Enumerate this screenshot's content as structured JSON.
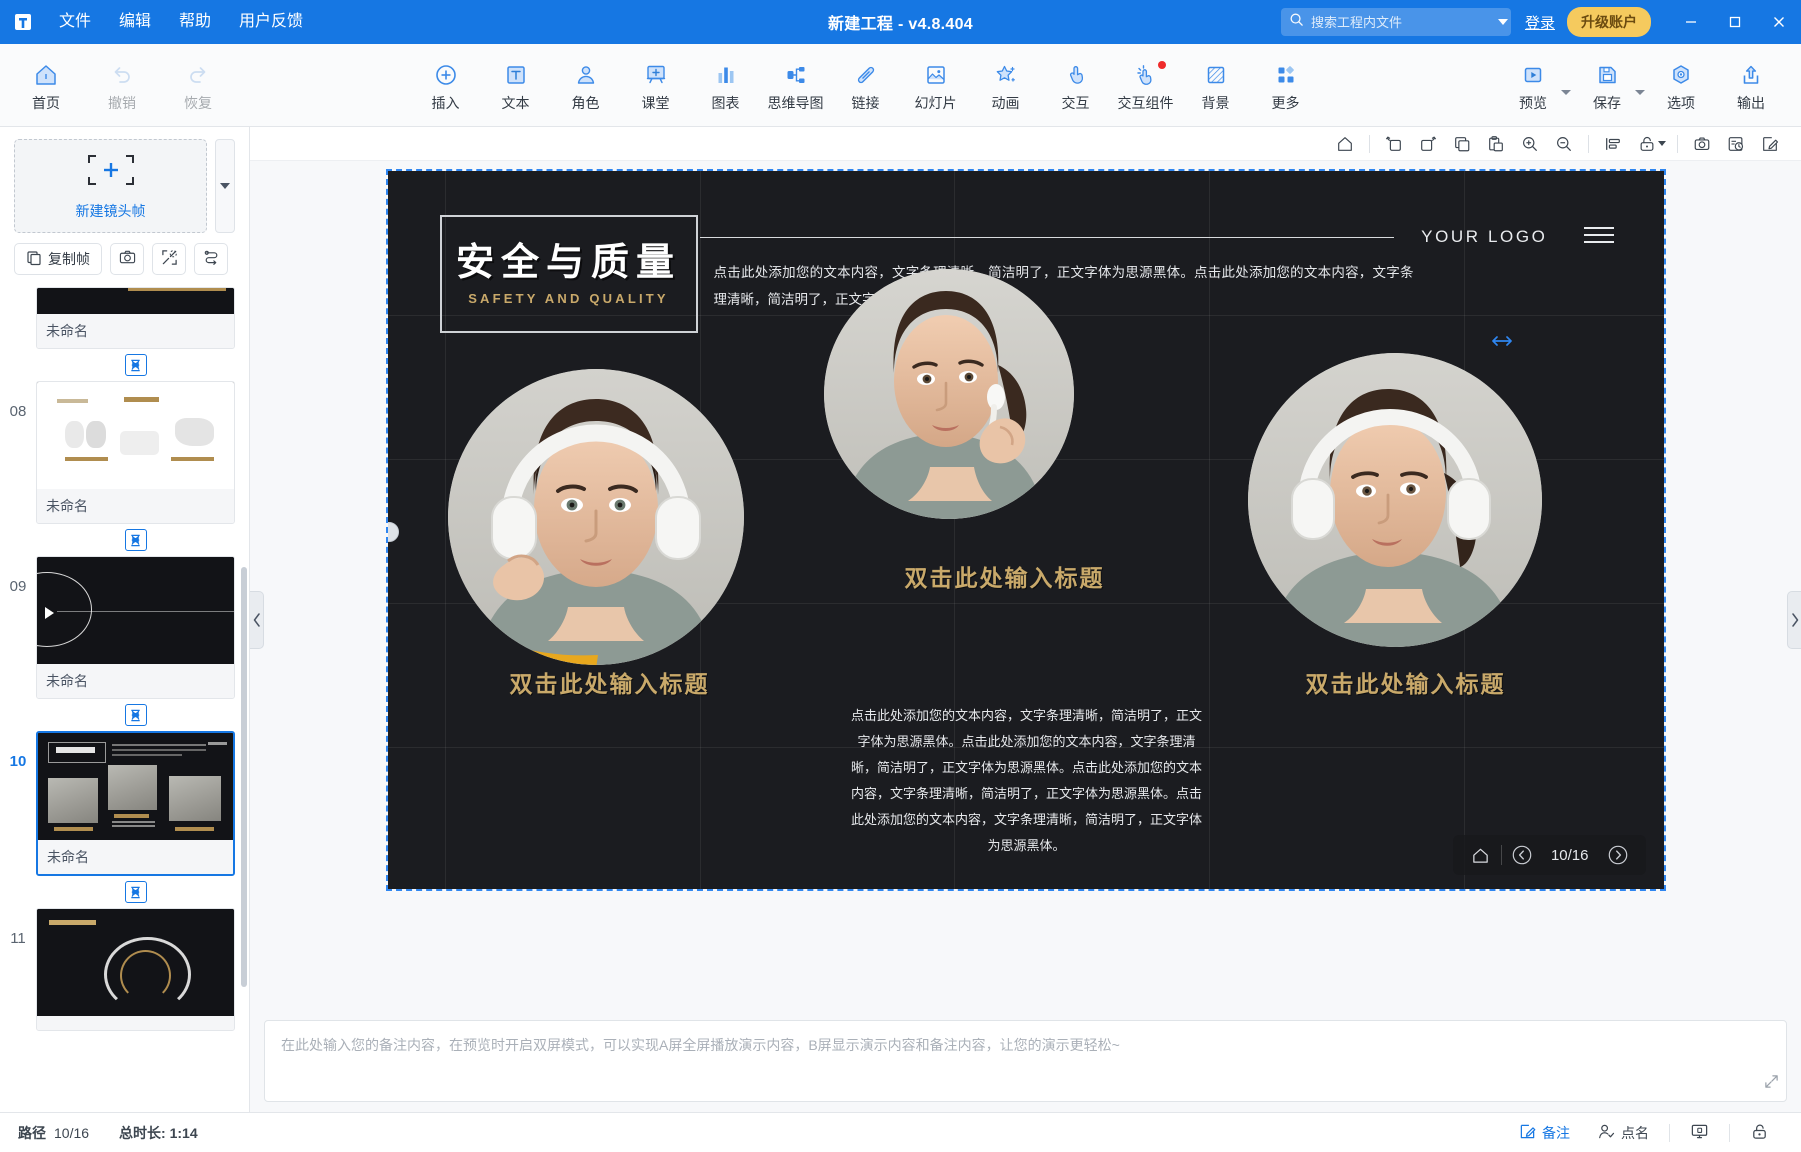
{
  "titlebar": {
    "logo_icon": "app-logo-icon",
    "menus": [
      "文件",
      "编辑",
      "帮助",
      "用户反馈"
    ],
    "window_title": "新建工程 - v4.8.404",
    "search": {
      "placeholder": "搜索工程内文件",
      "value": ""
    },
    "login_label": "登录",
    "upgrade_label": "升级账户",
    "minimize_icon": "minimize-icon",
    "maximize_icon": "maximize-icon",
    "close_icon": "close-icon"
  },
  "ribbon": {
    "left": [
      {
        "label": "首页",
        "icon": "home-icon",
        "disabled": false
      },
      {
        "label": "撤销",
        "icon": "undo-icon",
        "disabled": true
      },
      {
        "label": "恢复",
        "icon": "redo-icon",
        "disabled": true
      }
    ],
    "center": [
      {
        "label": "插入",
        "icon": "plus-circle-icon",
        "badge": false
      },
      {
        "label": "文本",
        "icon": "text-box-icon",
        "badge": false
      },
      {
        "label": "角色",
        "icon": "person-icon",
        "badge": false
      },
      {
        "label": "课堂",
        "icon": "classroom-icon",
        "badge": false
      },
      {
        "label": "图表",
        "icon": "bar-chart-icon",
        "badge": false
      },
      {
        "label": "思维导图",
        "icon": "mindmap-icon",
        "badge": false
      },
      {
        "label": "链接",
        "icon": "link-icon",
        "badge": false
      },
      {
        "label": "幻灯片",
        "icon": "slide-image-icon",
        "badge": false
      },
      {
        "label": "动画",
        "icon": "star-sparkle-icon",
        "badge": false
      },
      {
        "label": "交互",
        "icon": "hand-tap-icon",
        "badge": false
      },
      {
        "label": "交互组件",
        "icon": "hand-sparkle-icon",
        "badge": true
      },
      {
        "label": "背景",
        "icon": "background-icon",
        "badge": false
      },
      {
        "label": "更多",
        "icon": "grid-more-icon",
        "badge": false
      }
    ],
    "right": [
      {
        "label": "预览",
        "icon": "play-box-icon",
        "split": true
      },
      {
        "label": "保存",
        "icon": "save-disk-icon",
        "split": true
      },
      {
        "label": "选项",
        "icon": "gear-hex-icon",
        "split": false
      },
      {
        "label": "输出",
        "icon": "export-up-icon",
        "split": false
      }
    ]
  },
  "leftpanel": {
    "new_frame_label": "新建镜头帧",
    "new_frame_icon": "crosshair-plus-icon",
    "scroll_down_icon": "chevron-down-icon",
    "actions": [
      {
        "label": "复制帧",
        "icon": "copy-frame-icon",
        "wide": true
      },
      {
        "label": "",
        "icon": "camera-icon",
        "wide": false
      },
      {
        "label": "",
        "icon": "fit-frame-icon",
        "wide": false
      },
      {
        "label": "",
        "icon": "reorder-flow-icon",
        "wide": false
      }
    ],
    "transition_icon": "hourglass-transition-icon",
    "slides": [
      {
        "number": "",
        "caption": "未命名",
        "active": false,
        "kind": "dark-partial"
      },
      {
        "number": "08",
        "caption": "未命名",
        "active": false,
        "kind": "white-earbuds"
      },
      {
        "number": "09",
        "caption": "未命名",
        "active": false,
        "kind": "dark-circle"
      },
      {
        "number": "10",
        "caption": "未命名",
        "active": true,
        "kind": "dark-portraits"
      },
      {
        "number": "11",
        "caption": "",
        "active": false,
        "kind": "dark-gauge"
      }
    ]
  },
  "canvas_toolbar": [
    {
      "icon": "home-outline-icon",
      "name": "fit-home"
    },
    {
      "icon": "rotate-left-icon",
      "name": "rotate-left"
    },
    {
      "icon": "rotate-right-icon",
      "name": "rotate-right"
    },
    {
      "icon": "copy-icon",
      "name": "copy"
    },
    {
      "icon": "paste-icon",
      "name": "paste"
    },
    {
      "icon": "zoom-in-icon",
      "name": "zoom-in"
    },
    {
      "icon": "zoom-out-icon",
      "name": "zoom-out"
    },
    {
      "icon": "align-icon",
      "name": "align"
    },
    {
      "icon": "unlock-icon",
      "name": "lock-toggle"
    },
    {
      "icon": "camera-shot-icon",
      "name": "screenshot"
    },
    {
      "icon": "history-icon",
      "name": "history"
    },
    {
      "icon": "edit-note-icon",
      "name": "edit-note"
    }
  ],
  "slide": {
    "title_cn": "安全与质量",
    "title_en": "SAFETY AND QUALITY",
    "logo_text": "YOUR LOGO",
    "header_paragraph": "点击此处添加您的文本内容，文字条理清晰，简洁明了，正文字体为思源黑体。点击此处添加您的文本内容，文字条理清晰，简洁明了，正文字体为思源黑体。",
    "center_title": "双击此处输入标题",
    "center_paragraph": "点击此处添加您的文本内容，文字条理清晰，简洁明了，正文字体为思源黑体。点击此处添加您的文本内容，文字条理清晰，简洁明了，正文字体为思源黑体。点击此处添加您的文本内容，文字条理清晰，简洁明了，正文字体为思源黑体。点击此处添加您的文本内容，文字条理清晰，简洁明了，正文字体为思源黑体。",
    "left_caption": "双击此处输入标题",
    "right_caption": "双击此处输入标题",
    "page_indicator": "10/16",
    "page_home_icon": "home-outline-icon",
    "page_prev_icon": "chevron-left-circle-icon",
    "page_next_icon": "chevron-right-circle-icon",
    "resize_handle_icon": "horizontal-resize-icon"
  },
  "notes": {
    "placeholder": "在此处输入您的备注内容，在预览时开启双屏模式，可以实现A屏全屏播放演示内容，B屏显示演示内容和备注内容，让您的演示更轻松~",
    "value": "",
    "resize_icon": "resize-corner-icon"
  },
  "statusbar": {
    "path_label": "路径",
    "path_value": "10/16",
    "duration_label": "总时长: 1:14",
    "items": [
      {
        "label": "备注",
        "icon": "note-edit-icon",
        "active": true
      },
      {
        "label": "点名",
        "icon": "roll-call-icon",
        "active": false
      },
      {
        "label": "",
        "icon": "presenter-screen-icon",
        "active": false
      },
      {
        "label": "",
        "icon": "lock-open-icon",
        "active": false
      }
    ]
  },
  "colors": {
    "brand_blue": "#1677e3",
    "upgrade_yellow": "#f5ca5e",
    "gold": "#c9a96a",
    "stage_dark": "#1b1c20"
  }
}
